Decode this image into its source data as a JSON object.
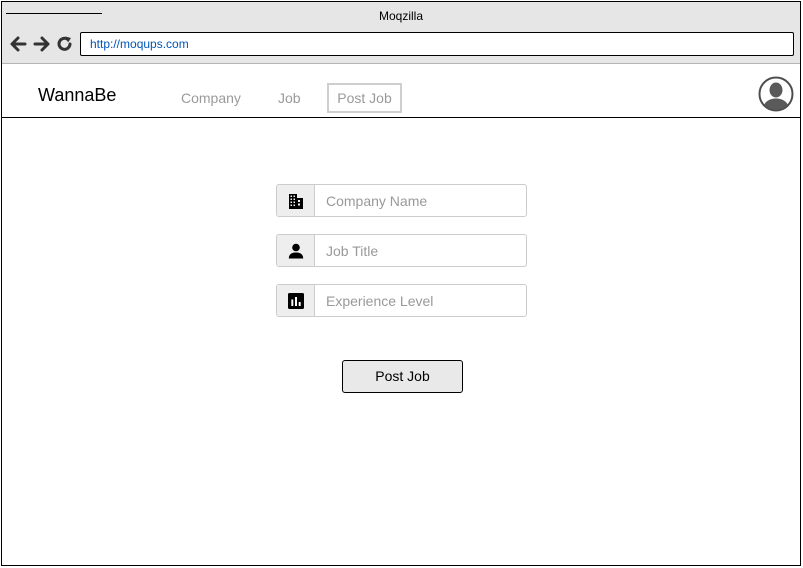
{
  "browser": {
    "window_title": "Moqzilla",
    "address": "http://moqups.com",
    "back_icon": "arrow-left-icon",
    "forward_icon": "arrow-right-icon",
    "reload_icon": "reload-icon"
  },
  "navbar": {
    "brand": "WannaBe",
    "links": [
      {
        "label": "Company"
      },
      {
        "label": "Job"
      },
      {
        "label": "Post Job"
      }
    ],
    "avatar_icon": "user-avatar-icon"
  },
  "form": {
    "fields": [
      {
        "icon": "building-icon",
        "placeholder": "Company Name",
        "value": ""
      },
      {
        "icon": "person-icon",
        "placeholder": "Job Title",
        "value": ""
      },
      {
        "icon": "bar-chart-icon",
        "placeholder": "Experience Level",
        "value": ""
      }
    ],
    "submit_label": "Post Job"
  },
  "colors": {
    "chrome_bg": "#e6e6e6",
    "link_blue": "#0055b8",
    "muted_text": "#9a9a9a",
    "button_bg": "#e9e9e9"
  }
}
